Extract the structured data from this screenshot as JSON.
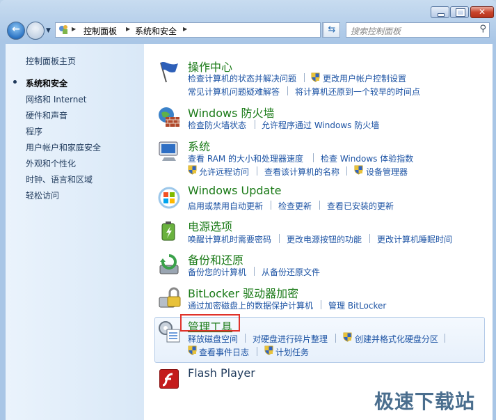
{
  "window": {
    "breadcrumbs": [
      "控制面板",
      "系统和安全"
    ],
    "search_placeholder": "搜索控制面板"
  },
  "sidebar": {
    "home": "控制面板主页",
    "items": [
      "系统和安全",
      "网络和 Internet",
      "硬件和声音",
      "程序",
      "用户帐户和家庭安全",
      "外观和个性化",
      "时钟、语言和区域",
      "轻松访问"
    ],
    "active_index": 0
  },
  "categories": [
    {
      "title": "操作中心",
      "icon": "flag-icon",
      "links": [
        "检查计算机的状态并解决问题",
        "更改用户帐户控制设置",
        "常见计算机问题疑难解答",
        "将计算机还原到一个较早的时间点"
      ]
    },
    {
      "title": "Windows 防火墙",
      "icon": "firewall-icon",
      "links": [
        "检查防火墙状态",
        "允许程序通过 Windows 防火墙"
      ]
    },
    {
      "title": "系统",
      "icon": "computer-icon",
      "links": [
        "查看 RAM 的大小和处理器速度",
        "检查 Windows 体验指数",
        "允许远程访问",
        "查看该计算机的名称",
        "设备管理器"
      ]
    },
    {
      "title": "Windows Update",
      "icon": "windows-update-icon",
      "links": [
        "启用或禁用自动更新",
        "检查更新",
        "查看已安装的更新"
      ]
    },
    {
      "title": "电源选项",
      "icon": "battery-icon",
      "links": [
        "唤醒计算机时需要密码",
        "更改电源按钮的功能",
        "更改计算机睡眠时间"
      ]
    },
    {
      "title": "备份和还原",
      "icon": "backup-icon",
      "links": [
        "备份您的计算机",
        "从备份还原文件"
      ]
    },
    {
      "title": "BitLocker 驱动器加密",
      "icon": "bitlocker-icon",
      "links": [
        "通过加密磁盘上的数据保护计算机",
        "管理 BitLocker"
      ]
    },
    {
      "title": "管理工具",
      "icon": "admin-tools-icon",
      "links": [
        "释放磁盘空间",
        "对硬盘进行碎片整理",
        "创建并格式化硬盘分区",
        "查看事件日志",
        "计划任务"
      ]
    },
    {
      "title": "Flash Player",
      "icon": "flash-icon",
      "links": []
    }
  ],
  "watermark": "极速下载站",
  "colors": {
    "title_green": "#1a7a17",
    "link_blue": "#1b52a3",
    "highlight_red": "#e0322a"
  }
}
